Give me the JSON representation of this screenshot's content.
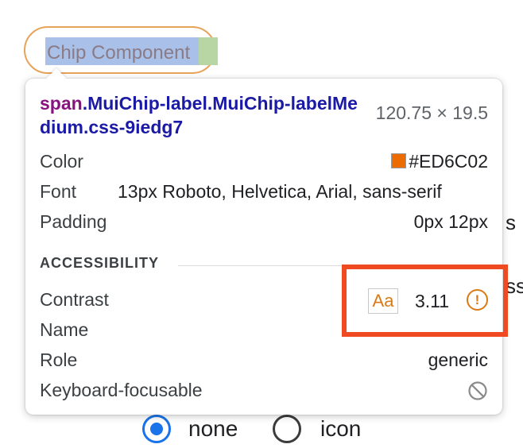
{
  "page": {
    "chip_label": "Chip Component",
    "peek_text_1": "s",
    "peek_text_2": "ss",
    "radio_options": [
      {
        "label": "none",
        "selected": true
      },
      {
        "label": "icon",
        "selected": false
      }
    ]
  },
  "tooltip": {
    "selector_tag": "span",
    "selector_classes": ".MuiChip-label.MuiChip-labelMedium.css-9iedg7",
    "dimensions": "120.75 × 19.5",
    "properties": {
      "color_label": "Color",
      "color_value": "#ED6C02",
      "font_label": "Font",
      "font_value": "13px Roboto, Helvetica, Arial, sans-serif",
      "padding_label": "Padding",
      "padding_value": "0px 12px"
    },
    "accessibility": {
      "heading": "ACCESSIBILITY",
      "contrast_label": "Contrast",
      "contrast_badge": "Aa",
      "contrast_value": "3.11",
      "name_label": "Name",
      "role_label": "Role",
      "role_value": "generic",
      "keyboard_label": "Keyboard-focusable"
    }
  },
  "colors": {
    "swatch": "#ED6C02",
    "warning": "#D97A16",
    "highlight_box": "#F04A23"
  },
  "icons": {
    "contrast_warning": "exclamation-circle-icon",
    "not_focusable": "prohibited-icon"
  }
}
